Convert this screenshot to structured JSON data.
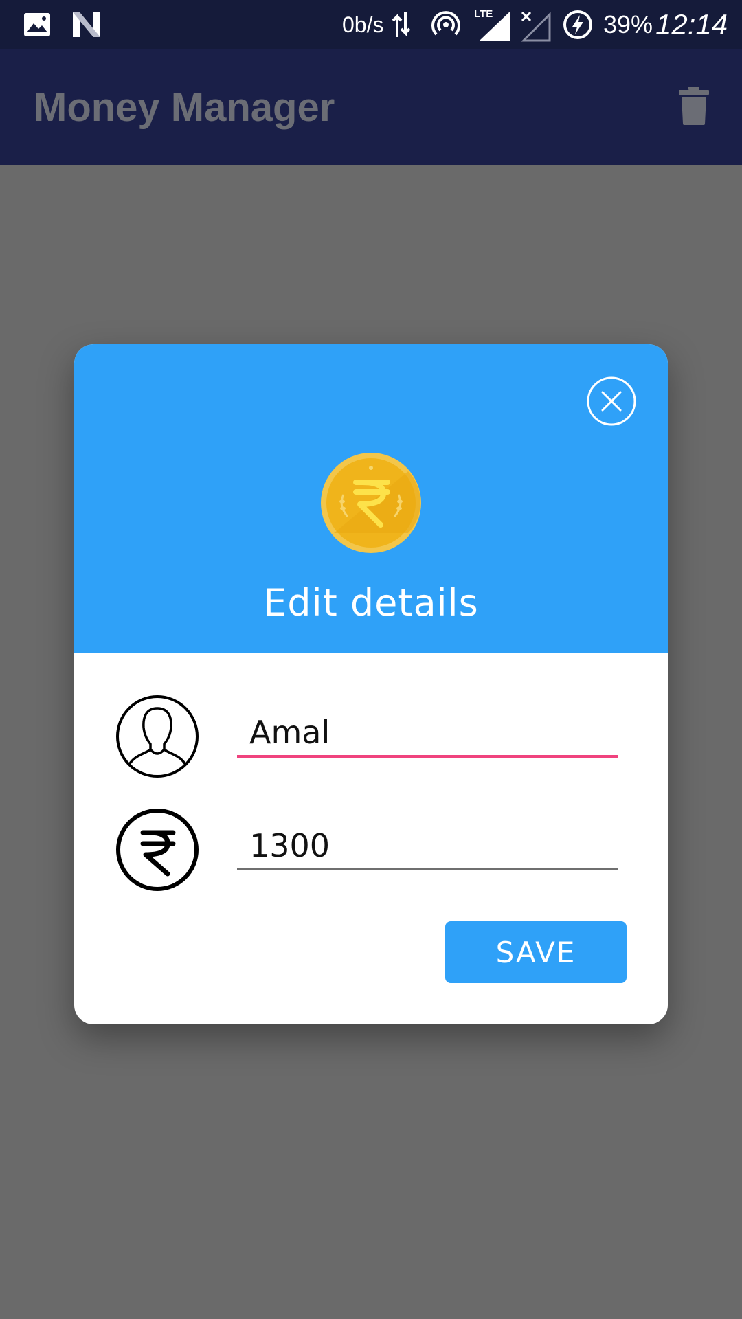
{
  "status_bar": {
    "net_speed": "0b/s",
    "network_type": "LTE",
    "battery": "39%",
    "time": "12:14",
    "icons": [
      "image-icon",
      "n-app-icon",
      "data-arrows-icon",
      "hotspot-icon",
      "lte-signal-icon",
      "no-signal-icon",
      "battery-charging-icon"
    ]
  },
  "app_bar": {
    "title": "Money Manager",
    "delete_icon": "trash-icon"
  },
  "dialog": {
    "close_icon": "close-circle-icon",
    "coin_icon": "rupee-coin-icon",
    "title": "Edit details",
    "name_icon": "person-icon",
    "name_value": "Amal",
    "amount_icon": "rupee-circle-icon",
    "amount_value": "1300",
    "save_label": "SAVE"
  },
  "colors": {
    "status_bar": "#151b3a",
    "app_bar": "#1a1f48",
    "scrim": "#6a6a6a",
    "dialog_header": "#2fa1f8",
    "focused_underline": "#f0437e",
    "save_button": "#2fa1f8"
  }
}
